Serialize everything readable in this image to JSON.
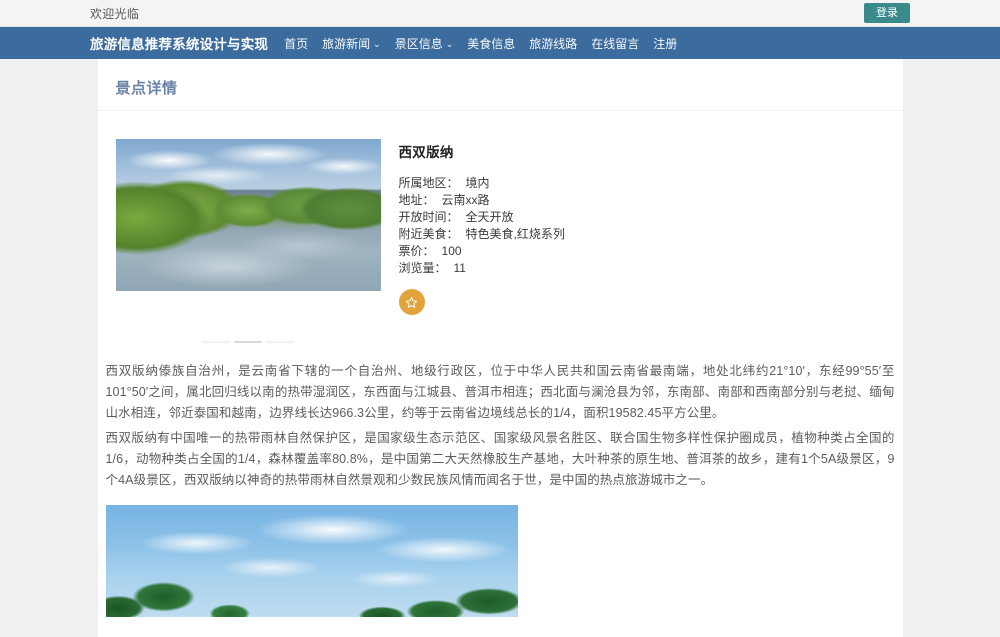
{
  "topbar": {
    "welcome": "欢迎光临",
    "login_label": "登录"
  },
  "nav": {
    "brand": "旅游信息推荐系统设计与实现",
    "items": [
      {
        "label": "首页",
        "has_caret": false
      },
      {
        "label": "旅游新闻",
        "has_caret": true
      },
      {
        "label": "景区信息",
        "has_caret": true
      },
      {
        "label": "美食信息",
        "has_caret": false
      },
      {
        "label": "旅游线路",
        "has_caret": false
      },
      {
        "label": "在线留言",
        "has_caret": false
      },
      {
        "label": "注册",
        "has_caret": false
      }
    ],
    "caret_glyph": "⌄"
  },
  "card": {
    "title": "景点详情"
  },
  "spot": {
    "name": "西双版纳",
    "fields": [
      {
        "label": "所属地区：",
        "value": "境内"
      },
      {
        "label": "地址：",
        "value": "云南xx路"
      },
      {
        "label": "开放时间：",
        "value": "全天开放"
      },
      {
        "label": "附近美食：",
        "value": "特色美食,红烧系列"
      },
      {
        "label": "票价：",
        "value": "100"
      },
      {
        "label": "浏览量：",
        "value": "11"
      }
    ],
    "favorite_icon": "star-icon"
  },
  "carousel": {
    "slide_count": 3,
    "active_index": 1,
    "main_image_alt": "西双版纳河流风光"
  },
  "content": {
    "paragraphs": [
      "西双版纳傣族自治州，是云南省下辖的一个自治州、地级行政区，位于中华人民共和国云南省最南端，地处北纬约21°10′，东经99°55′至101°50′之间，属北回归线以南的热带湿润区，东西面与江城县、普洱市相连；西北面与澜沧县为邻，东南部、南部和西南部分别与老挝、缅甸山水相连，邻近泰国和越南，边界线长达966.3公里，约等于云南省边境线总长的1/4，面积19582.45平方公里。",
      "西双版纳有中国唯一的热带雨林自然保护区，是国家级生态示范区、国家级风景名胜区、联合国生物多样性保护圈成员，植物种类占全国的1/6，动物种类占全国的1/4，森林覆盖率80.8%，是中国第二大天然橡胶生产基地，大叶种茶的原生地、普洱茶的故乡，建有1个5A级景区，9个4A级景区，西双版纳以神奇的热带雨林自然景观和少数民族风情而闻名于世，是中国的热点旅游城市之一。"
    ],
    "bottom_image_alt": "椰林蓝天风光"
  },
  "colors": {
    "navbar": "#3c6c9e",
    "login_button": "#3a8a8c",
    "card_title": "#6b84a6",
    "favorite_button": "#e2a33c",
    "page_background": "#f0f0f0"
  }
}
